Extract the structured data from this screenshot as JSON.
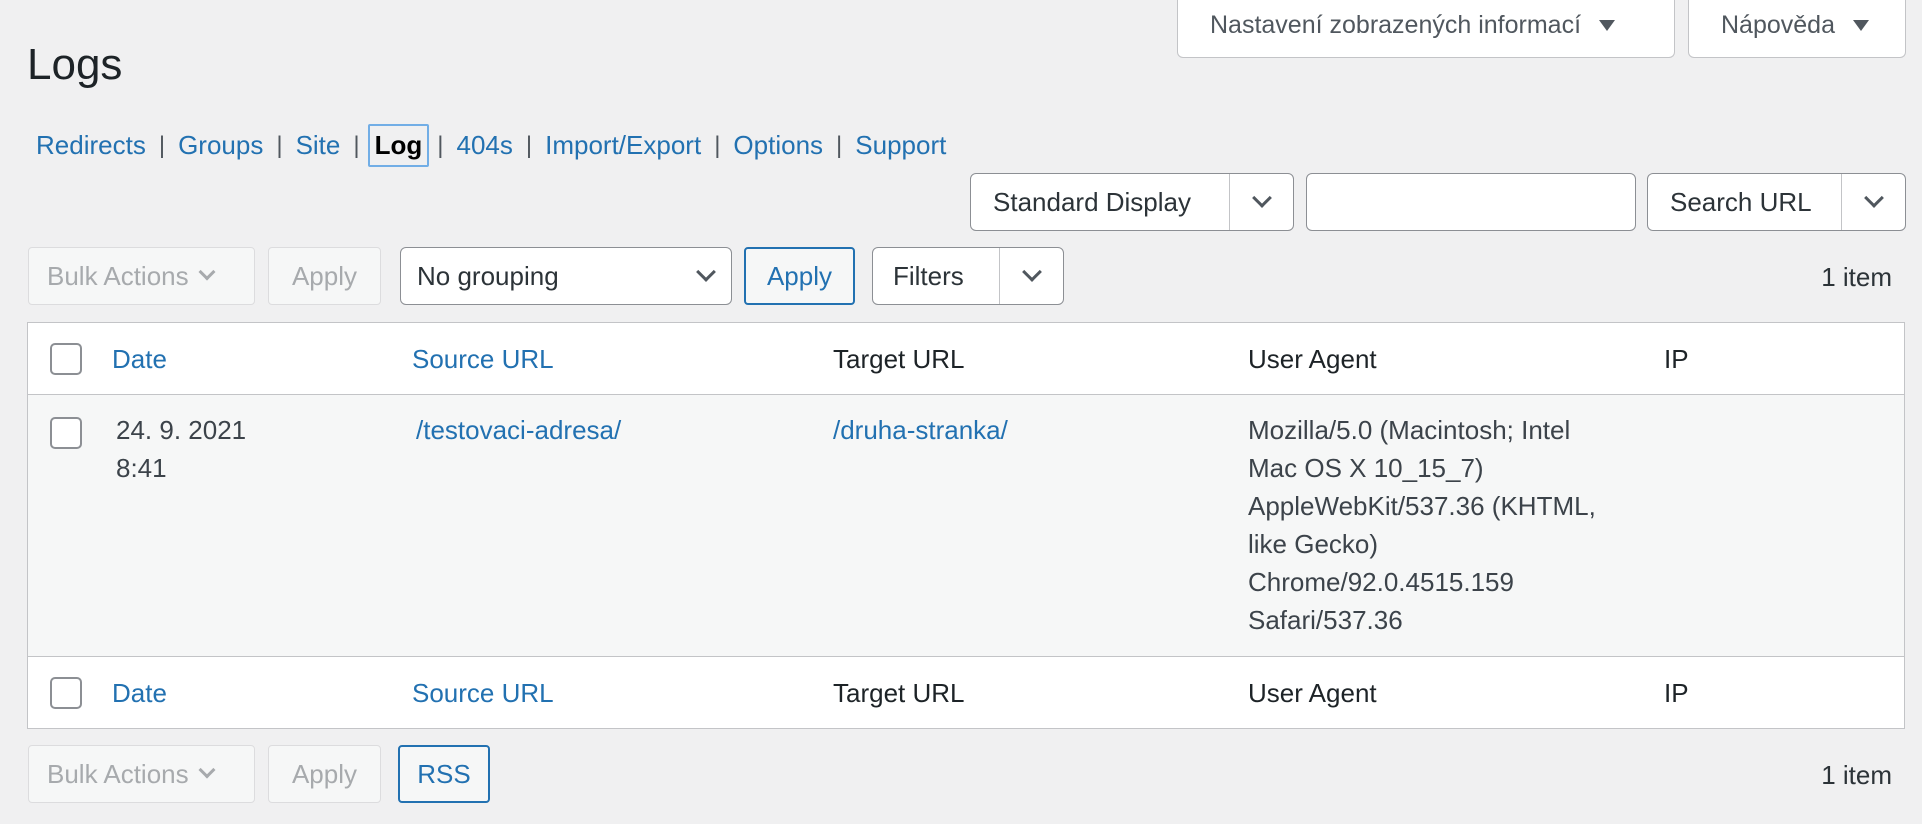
{
  "screen_options": {
    "label": "Nastavení zobrazených informací"
  },
  "help": {
    "label": "Nápověda"
  },
  "page_title": "Logs",
  "subnav": {
    "items": [
      "Redirects",
      "Groups",
      "Site",
      "Log",
      "404s",
      "Import/Export",
      "Options",
      "Support"
    ],
    "separator": "|",
    "current": "Log"
  },
  "display_select": {
    "value": "Standard Display"
  },
  "search": {
    "value": "",
    "type_select": "Search URL"
  },
  "top_toolbar": {
    "bulk_actions": "Bulk Actions",
    "apply": "Apply",
    "grouping": "No grouping",
    "grouping_apply": "Apply",
    "filters": "Filters",
    "count": "1 item"
  },
  "table": {
    "columns": [
      "Date",
      "Source URL",
      "Target URL",
      "User Agent",
      "IP"
    ],
    "rows": [
      {
        "date_line1": "24. 9. 2021",
        "date_line2": "8:41",
        "source_url": "/testovaci-adresa/",
        "target_url": "/druha-stranka/",
        "user_agent_lines": [
          "Mozilla/5.0 (Macintosh; Intel",
          "Mac OS X 10_15_7)",
          "AppleWebKit/537.36 (KHTML,",
          "like Gecko)",
          "Chrome/92.0.4515.159",
          "Safari/537.36"
        ],
        "ip": ""
      }
    ]
  },
  "bottom_toolbar": {
    "bulk_actions": "Bulk Actions",
    "apply": "Apply",
    "rss": "RSS",
    "count": "1 item"
  },
  "colors": {
    "accent": "#2271b1",
    "background": "#f0f0f1",
    "text": "#1d2327"
  }
}
